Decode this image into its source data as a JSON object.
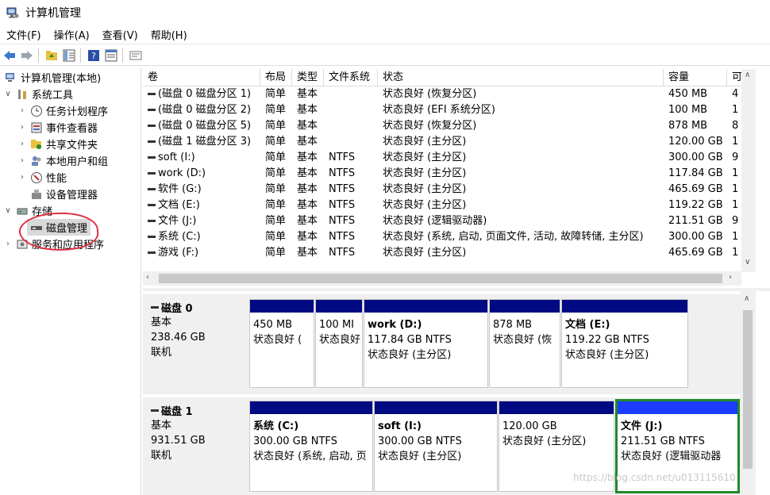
{
  "window": {
    "title": "计算机管理"
  },
  "menus": [
    "文件(F)",
    "操作(A)",
    "查看(V)",
    "帮助(H)"
  ],
  "tree": [
    {
      "label": "计算机管理(本地)"
    },
    {
      "label": "系统工具"
    },
    {
      "label": "任务计划程序"
    },
    {
      "label": "事件查看器"
    },
    {
      "label": "共享文件夹"
    },
    {
      "label": "本地用户和组"
    },
    {
      "label": "性能"
    },
    {
      "label": "设备管理器"
    },
    {
      "label": "存储"
    },
    {
      "label": "磁盘管理"
    },
    {
      "label": "服务和应用程序"
    }
  ],
  "table": {
    "headers": [
      "卷",
      "布局",
      "类型",
      "文件系统",
      "状态",
      "容量",
      "可"
    ],
    "rows": [
      [
        "(磁盘 0 磁盘分区 1)",
        "简单",
        "基本",
        "",
        "状态良好 (恢复分区)",
        "450 MB",
        "4"
      ],
      [
        "(磁盘 0 磁盘分区 2)",
        "简单",
        "基本",
        "",
        "状态良好 (EFI 系统分区)",
        "100 MB",
        "1"
      ],
      [
        "(磁盘 0 磁盘分区 5)",
        "简单",
        "基本",
        "",
        "状态良好 (恢复分区)",
        "878 MB",
        "8"
      ],
      [
        "(磁盘 1 磁盘分区 3)",
        "简单",
        "基本",
        "",
        "状态良好 (主分区)",
        "120.00 GB",
        "1"
      ],
      [
        "soft (I:)",
        "简单",
        "基本",
        "NTFS",
        "状态良好 (主分区)",
        "300.00 GB",
        "9"
      ],
      [
        "work (D:)",
        "简单",
        "基本",
        "NTFS",
        "状态良好 (主分区)",
        "117.84 GB",
        "1"
      ],
      [
        "软件 (G:)",
        "简单",
        "基本",
        "NTFS",
        "状态良好 (主分区)",
        "465.69 GB",
        "1"
      ],
      [
        "文档 (E:)",
        "简单",
        "基本",
        "NTFS",
        "状态良好 (主分区)",
        "119.22 GB",
        "1"
      ],
      [
        "文件 (J:)",
        "简单",
        "基本",
        "NTFS",
        "状态良好 (逻辑驱动器)",
        "211.51 GB",
        "9"
      ],
      [
        "系统 (C:)",
        "简单",
        "基本",
        "NTFS",
        "状态良好 (系统, 启动, 页面文件, 活动, 故障转储, 主分区)",
        "300.00 GB",
        "1"
      ],
      [
        "游戏 (F:)",
        "简单",
        "基本",
        "NTFS",
        "状态良好 (主分区)",
        "465.69 GB",
        "1"
      ]
    ]
  },
  "disks": [
    {
      "name": "磁盘 0",
      "type": "基本",
      "size": "238.46 GB",
      "status": "联机",
      "partitions": [
        {
          "name": "",
          "size": "450 MB",
          "status": "状态良好 ("
        },
        {
          "name": "",
          "size": "100 MI",
          "status": "状态良好"
        },
        {
          "name": "work (D:)",
          "size": "117.84 GB NTFS",
          "status": "状态良好 (主分区)"
        },
        {
          "name": "",
          "size": "878 MB",
          "status": "状态良好 (恢"
        },
        {
          "name": "文档 (E:)",
          "size": "119.22 GB NTFS",
          "status": "状态良好 (主分区)"
        }
      ]
    },
    {
      "name": "磁盘 1",
      "type": "基本",
      "size": "931.51 GB",
      "status": "联机",
      "partitions": [
        {
          "name": "系统 (C:)",
          "size": "300.00 GB NTFS",
          "status": "状态良好 (系统, 启动, 页"
        },
        {
          "name": "soft (I:)",
          "size": "300.00 GB NTFS",
          "status": "状态良好 (主分区)"
        },
        {
          "name": "",
          "size": "120.00 GB",
          "status": "状态良好 (主分区)"
        },
        {
          "name": "文件 (J:)",
          "size": "211.51 GB NTFS",
          "status": "状态良好 (逻辑驱动器"
        }
      ]
    }
  ],
  "watermark": "https://blog.csdn.net/u013115610",
  "colors": {
    "partition_bar": "#000a82",
    "selected_border": "#1e8a2a",
    "annotation_circle": "#e03040"
  }
}
